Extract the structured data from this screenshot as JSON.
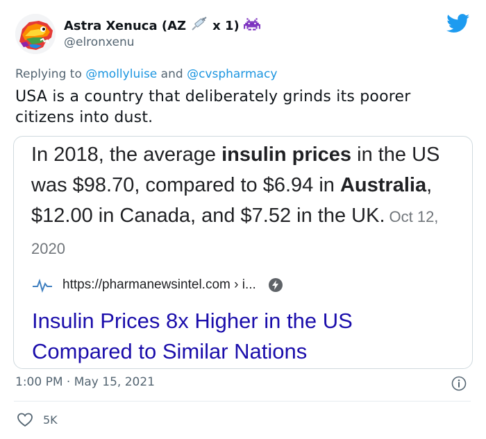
{
  "author": {
    "name_part1": "Astra Xenuca (AZ",
    "name_part2": "x 1)",
    "handle": "@elronxenu",
    "name_icons": [
      "syringe-emoji",
      "space-invader-emoji"
    ]
  },
  "reply": {
    "prefix": "Replying to",
    "mention1": "@mollyluise",
    "conjunction": "and",
    "mention2": "@cvspharmacy"
  },
  "tweet": {
    "text": "USA is a country that deliberately grinds its poorer citizens into dust."
  },
  "card": {
    "snippet": {
      "s1": "In 2018, the average ",
      "b1": "insulin prices",
      "s2": " in the US was $98.70, compared to $6.94 in ",
      "b2": "Australia",
      "s3": ", $12.00 in Canada, and $7.52 in the UK.",
      "date": "Oct 12, 2020"
    },
    "source_url": "https://pharmanewsintel.com › i...",
    "headline": "Insulin Prices 8x Higher in the US Compared to Similar Nations"
  },
  "meta": {
    "time": "1:00 PM",
    "separator": "·",
    "date": "May 15, 2021"
  },
  "likes": {
    "count": "5K"
  },
  "colors": {
    "twitter_blue": "#1d9bf0",
    "link_blue": "#1a0dab",
    "secondary_text": "#536471",
    "border": "#cfd9de"
  }
}
